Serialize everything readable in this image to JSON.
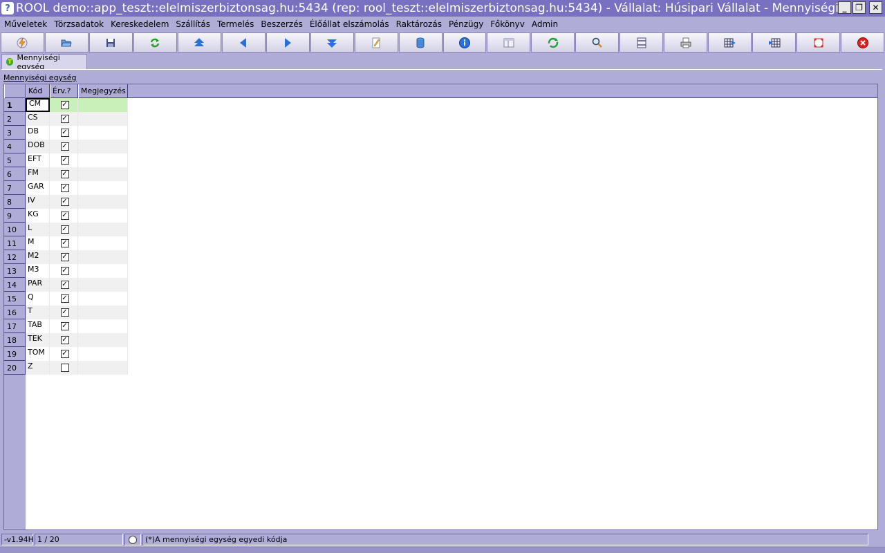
{
  "window": {
    "title": "ROOL demo::app_teszt::elelmiszerbiztonsag.hu:5434 (rep: rool_teszt::elelmiszerbiztonsag.hu:5434) - Vállalat: Húsipari Vállalat - Mennyiségi e...",
    "minimize": "_",
    "restore": "❐",
    "close": "✕"
  },
  "menu": [
    "Műveletek",
    "Törzsadatok",
    "Kereskedelem",
    "Szállítás",
    "Termelés",
    "Beszerzés",
    "Élőállat elszámolás",
    "Raktározás",
    "Pénzügy",
    "Főkönyv",
    "Admin"
  ],
  "toolbar": {
    "buttons": [
      "lightning-icon",
      "open-folder-icon",
      "save-icon",
      "refresh-green-icon",
      "first-record-icon",
      "previous-record-icon",
      "next-record-icon",
      "last-record-icon",
      "edit-pencil-icon",
      "database-icon",
      "info-icon",
      "form-view-icon",
      "reload-icon",
      "search-icon",
      "columns-icon",
      "print-icon",
      "grid-export-icon",
      "grid-import-icon",
      "fullscreen-icon",
      "exit-icon"
    ]
  },
  "tab": {
    "label": "Mennyiségi egység"
  },
  "panel": {
    "label": "Mennyiségi egység"
  },
  "grid": {
    "columns": [
      "Kód",
      "Érv.?",
      "Megjegyzés"
    ],
    "rows": [
      {
        "num": "1",
        "code": "CM",
        "valid": "✓",
        "note": ""
      },
      {
        "num": "2",
        "code": "CS",
        "valid": "✓",
        "note": ""
      },
      {
        "num": "3",
        "code": "DB",
        "valid": "✓",
        "note": ""
      },
      {
        "num": "4",
        "code": "DOB",
        "valid": "✓",
        "note": ""
      },
      {
        "num": "5",
        "code": "EFT",
        "valid": "✓",
        "note": ""
      },
      {
        "num": "6",
        "code": "FM",
        "valid": "✓",
        "note": ""
      },
      {
        "num": "7",
        "code": "GAR",
        "valid": "✓",
        "note": ""
      },
      {
        "num": "8",
        "code": "IV",
        "valid": "✓",
        "note": ""
      },
      {
        "num": "9",
        "code": "KG",
        "valid": "✓",
        "note": ""
      },
      {
        "num": "10",
        "code": "L",
        "valid": "✓",
        "note": ""
      },
      {
        "num": "11",
        "code": "M",
        "valid": "✓",
        "note": ""
      },
      {
        "num": "12",
        "code": "M2",
        "valid": "✓",
        "note": ""
      },
      {
        "num": "13",
        "code": "M3",
        "valid": "✓",
        "note": ""
      },
      {
        "num": "14",
        "code": "PAR",
        "valid": "✓",
        "note": ""
      },
      {
        "num": "15",
        "code": "Q",
        "valid": "✓",
        "note": ""
      },
      {
        "num": "16",
        "code": "T",
        "valid": "✓",
        "note": ""
      },
      {
        "num": "17",
        "code": "TAB",
        "valid": "✓",
        "note": ""
      },
      {
        "num": "18",
        "code": "TEK",
        "valid": "✓",
        "note": ""
      },
      {
        "num": "19",
        "code": "TOM",
        "valid": "✓",
        "note": ""
      },
      {
        "num": "20",
        "code": "Z",
        "valid": "",
        "note": ""
      }
    ]
  },
  "status": {
    "version": "-v1.94H",
    "position": "1 / 20",
    "hint": "(*)A mennyiségi egység egyedi kódja"
  }
}
